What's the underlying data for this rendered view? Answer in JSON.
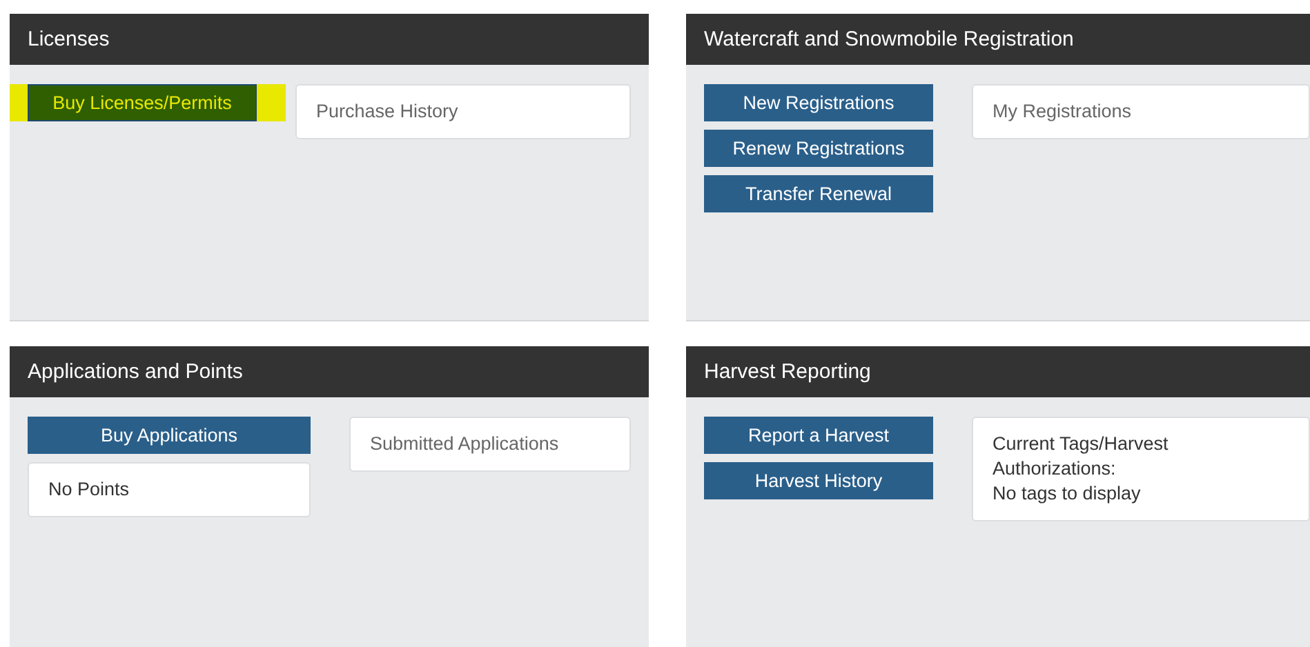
{
  "panels": [
    {
      "title": "Licenses",
      "left": [
        {
          "kind": "button",
          "label": "Buy Licenses/Permits",
          "highlighted": true
        }
      ],
      "right": [
        {
          "kind": "card",
          "lines": [
            "Purchase History"
          ]
        }
      ]
    },
    {
      "title": "Watercraft and Snowmobile Registration",
      "left": [
        {
          "kind": "button",
          "label": "New Registrations",
          "highlighted": false
        },
        {
          "kind": "button",
          "label": "Renew Registrations",
          "highlighted": false
        },
        {
          "kind": "button",
          "label": "Transfer Renewal",
          "highlighted": false
        }
      ],
      "right": [
        {
          "kind": "card",
          "lines": [
            "My Registrations"
          ]
        }
      ]
    },
    {
      "title": "Applications and Points",
      "left": [
        {
          "kind": "button",
          "label": "Buy Applications",
          "highlighted": false
        },
        {
          "kind": "card",
          "lines": [
            "No Points"
          ]
        }
      ],
      "right": [
        {
          "kind": "card",
          "lines": [
            "Submitted Applications"
          ]
        }
      ]
    },
    {
      "title": "Harvest Reporting",
      "left": [
        {
          "kind": "button",
          "label": "Report a Harvest",
          "highlighted": false
        },
        {
          "kind": "button",
          "label": "Harvest History",
          "highlighted": false
        }
      ],
      "right": [
        {
          "kind": "card",
          "lines": [
            "Current Tags/Harvest",
            "Authorizations:",
            "No tags to display"
          ]
        }
      ]
    }
  ]
}
